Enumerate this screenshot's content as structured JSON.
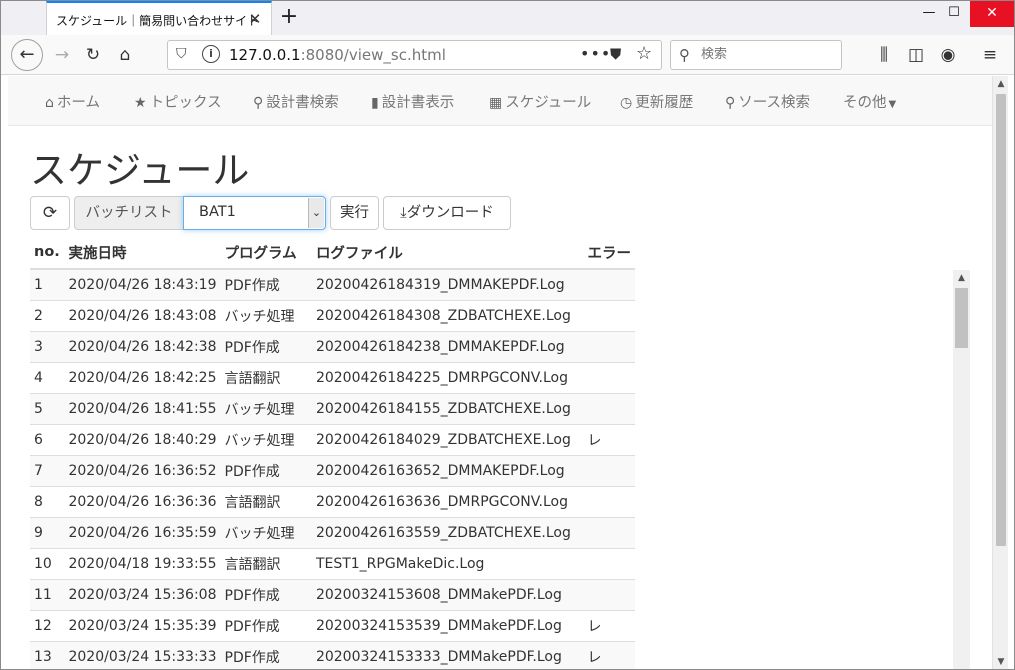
{
  "browser": {
    "tab_title": "スケジュール｜簡易問い合わせサイト",
    "url_host": "127.0.0.1",
    "url_path": ":8080/view_sc.html",
    "search_placeholder": "検索"
  },
  "site_nav": {
    "items": [
      {
        "icon": "home-icon",
        "label": "ホーム"
      },
      {
        "icon": "star-icon",
        "label": "トピックス"
      },
      {
        "icon": "search-icon",
        "label": "設計書検索"
      },
      {
        "icon": "book-icon",
        "label": "設計書表示"
      },
      {
        "icon": "calendar-icon",
        "label": "スケジュール"
      },
      {
        "icon": "clock-icon",
        "label": "更新履歴"
      },
      {
        "icon": "search-icon",
        "label": "ソース検索"
      },
      {
        "icon": "caret-down-icon",
        "label": "その他"
      }
    ]
  },
  "page": {
    "title": "スケジュール",
    "batch_label": "バッチリスト",
    "batch_selected": "BAT1",
    "run_label": "実行",
    "download_label": "ダウンロード"
  },
  "table": {
    "headers": [
      "no.",
      "実施日時",
      "プログラム",
      "ログファイル",
      "エラー"
    ],
    "rows": [
      [
        "1",
        "2020/04/26 18:43:19",
        "PDF作成",
        "20200426184319_DMMAKEPDF.Log",
        ""
      ],
      [
        "2",
        "2020/04/26 18:43:08",
        "バッチ処理",
        "20200426184308_ZDBATCHEXE.Log",
        ""
      ],
      [
        "3",
        "2020/04/26 18:42:38",
        "PDF作成",
        "20200426184238_DMMAKEPDF.Log",
        ""
      ],
      [
        "4",
        "2020/04/26 18:42:25",
        "言語翻訳",
        "20200426184225_DMRPGCONV.Log",
        ""
      ],
      [
        "5",
        "2020/04/26 18:41:55",
        "バッチ処理",
        "20200426184155_ZDBATCHEXE.Log",
        ""
      ],
      [
        "6",
        "2020/04/26 18:40:29",
        "バッチ処理",
        "20200426184029_ZDBATCHEXE.Log",
        "レ"
      ],
      [
        "7",
        "2020/04/26 16:36:52",
        "PDF作成",
        "20200426163652_DMMAKEPDF.Log",
        ""
      ],
      [
        "8",
        "2020/04/26 16:36:36",
        "言語翻訳",
        "20200426163636_DMRPGCONV.Log",
        ""
      ],
      [
        "9",
        "2020/04/26 16:35:59",
        "バッチ処理",
        "20200426163559_ZDBATCHEXE.Log",
        ""
      ],
      [
        "10",
        "2020/04/18 19:33:55",
        "言語翻訳",
        "TEST1_RPGMakeDic.Log",
        ""
      ],
      [
        "11",
        "2020/03/24 15:36:08",
        "PDF作成",
        "20200324153608_DMMakePDF.Log",
        ""
      ],
      [
        "12",
        "2020/03/24 15:35:39",
        "PDF作成",
        "20200324153539_DMMakePDF.Log",
        "レ"
      ],
      [
        "13",
        "2020/03/24 15:33:33",
        "PDF作成",
        "20200324153333_DMMakePDF.Log",
        "レ"
      ]
    ]
  }
}
